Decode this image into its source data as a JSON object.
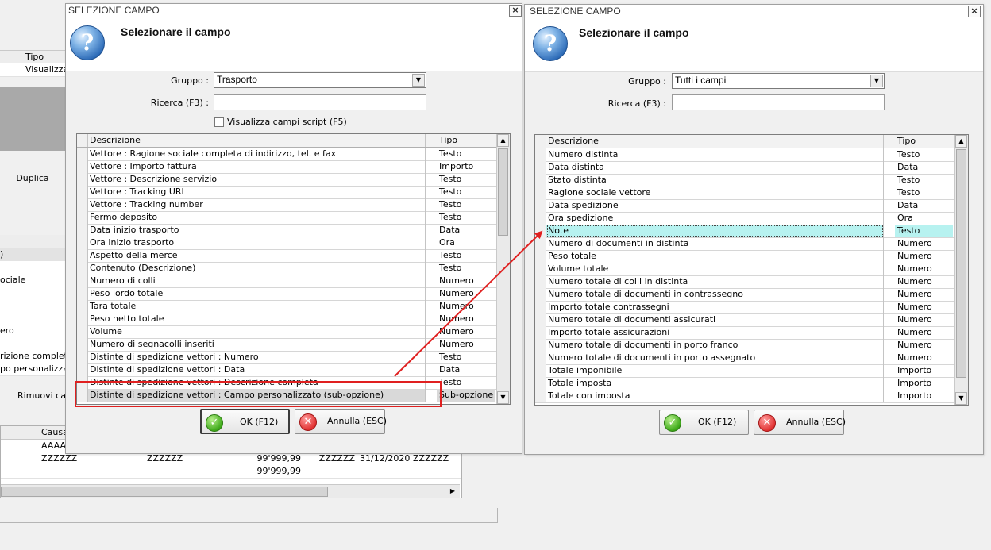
{
  "background_app": {
    "col_tipo": "Tipo",
    "row_visualizza": "Visualizza",
    "duplica_button": "Duplica",
    "left_paren": ")",
    "row_labels": [
      "ociale",
      "ero",
      "rizione completa",
      "po personalizzat"
    ],
    "rimuovi_button": "Rimuovi cam",
    "grid_header_causale": "Causa",
    "grid_rows": [
      {
        "col1": "",
        "col2": "AAAA",
        "col3": "",
        "col4": "",
        "col5": "",
        "col6": "",
        "col7": ""
      },
      {
        "col1": "",
        "col2": "ZZZZZZ",
        "col3": "ZZZZZZ",
        "col4": "99'999,99",
        "col5": "ZZZZZZ",
        "col6": "31/12/2020",
        "col7": "ZZZZZZ"
      },
      {
        "col1": "",
        "col2": "",
        "col3": "",
        "col4": "99'999,99",
        "col5": "",
        "col6": "",
        "col7": ""
      }
    ]
  },
  "dialog_left": {
    "window_title": "SELEZIONE CAMPO",
    "close_glyph": "×",
    "header_text": "Selezionare il campo",
    "gruppo_label": "Gruppo :",
    "gruppo_value": "Trasporto",
    "ricerca_label": "Ricerca (F3) :",
    "ricerca_value": "",
    "checkbox_label": "Visualizza campi script (F5)",
    "col_descrizione": "Descrizione",
    "col_tipo": "Tipo",
    "rows": [
      {
        "desc": "Vettore : Ragione sociale completa di indirizzo, tel. e fax",
        "type": "Testo"
      },
      {
        "desc": "Vettore : Importo fattura",
        "type": "Importo"
      },
      {
        "desc": "Vettore : Descrizione servizio",
        "type": "Testo"
      },
      {
        "desc": "Vettore : Tracking URL",
        "type": "Testo"
      },
      {
        "desc": "Vettore : Tracking number",
        "type": "Testo"
      },
      {
        "desc": "Fermo deposito",
        "type": "Testo"
      },
      {
        "desc": "Data inizio trasporto",
        "type": "Data"
      },
      {
        "desc": "Ora inizio trasporto",
        "type": "Ora"
      },
      {
        "desc": "Aspetto della merce",
        "type": "Testo"
      },
      {
        "desc": "Contenuto (Descrizione)",
        "type": "Testo"
      },
      {
        "desc": "Numero di colli",
        "type": "Numero"
      },
      {
        "desc": "Peso lordo totale",
        "type": "Numero"
      },
      {
        "desc": "Tara totale",
        "type": "Numero"
      },
      {
        "desc": "Peso netto totale",
        "type": "Numero"
      },
      {
        "desc": "Volume",
        "type": "Numero"
      },
      {
        "desc": "Numero di segnacolli inseriti",
        "type": "Numero"
      },
      {
        "desc": "Distinte di spedizione vettori : Numero",
        "type": "Testo"
      },
      {
        "desc": "Distinte di spedizione vettori : Data",
        "type": "Data"
      },
      {
        "desc": "Distinte di spedizione vettori : Descrizione completa",
        "type": "Testo"
      },
      {
        "desc": "Distinte di spedizione vettori : Campo personalizzato (sub-opzione)",
        "type": "Sub-opzione"
      }
    ],
    "ok_label": "OK (F12)",
    "cancel_label": "Annulla (ESC)"
  },
  "dialog_right": {
    "window_title": "SELEZIONE CAMPO",
    "close_glyph": "×",
    "header_text": "Selezionare il campo",
    "gruppo_label": "Gruppo :",
    "gruppo_value": "Tutti i campi",
    "ricerca_label": "Ricerca (F3) :",
    "ricerca_value": "",
    "col_descrizione": "Descrizione",
    "col_tipo": "Tipo",
    "rows": [
      {
        "desc": "Numero distinta",
        "type": "Testo"
      },
      {
        "desc": "Data distinta",
        "type": "Data"
      },
      {
        "desc": "Stato distinta",
        "type": "Testo"
      },
      {
        "desc": "Ragione sociale vettore",
        "type": "Testo"
      },
      {
        "desc": "Data spedizione",
        "type": "Data"
      },
      {
        "desc": "Ora spedizione",
        "type": "Ora"
      },
      {
        "desc": "Note",
        "type": "Testo"
      },
      {
        "desc": "Numero di documenti in distinta",
        "type": "Numero"
      },
      {
        "desc": "Peso totale",
        "type": "Numero"
      },
      {
        "desc": "Volume totale",
        "type": "Numero"
      },
      {
        "desc": "Numero totale di colli in distinta",
        "type": "Numero"
      },
      {
        "desc": "Numero totale di documenti in contrassegno",
        "type": "Numero"
      },
      {
        "desc": "Importo totale contrassegni",
        "type": "Numero"
      },
      {
        "desc": "Numero totale di documenti assicurati",
        "type": "Numero"
      },
      {
        "desc": "Importo totale assicurazioni",
        "type": "Numero"
      },
      {
        "desc": "Numero totale di documenti in porto franco",
        "type": "Numero"
      },
      {
        "desc": "Numero totale di documenti in porto assegnato",
        "type": "Numero"
      },
      {
        "desc": "Totale imponibile",
        "type": "Importo"
      },
      {
        "desc": "Totale imposta",
        "type": "Importo"
      },
      {
        "desc": "Totale con imposta",
        "type": "Importo"
      }
    ],
    "ok_label": "OK (F12)",
    "cancel_label": "Annulla (ESC)"
  },
  "icons": {
    "help": "question-mark",
    "ok": "check-mark",
    "cancel": "x-mark",
    "help_glyph": "?",
    "ok_glyph": "✓",
    "cancel_glyph": "✕",
    "scroll_up_glyph": "▲",
    "scroll_down_glyph": "▼",
    "scroll_right_glyph": "▶",
    "combo_arrow_glyph": "▼"
  },
  "colors": {
    "selected_gray": "#d9d9d9",
    "selected_cyan": "#b7f2f0",
    "annotation_red": "#e02020"
  }
}
